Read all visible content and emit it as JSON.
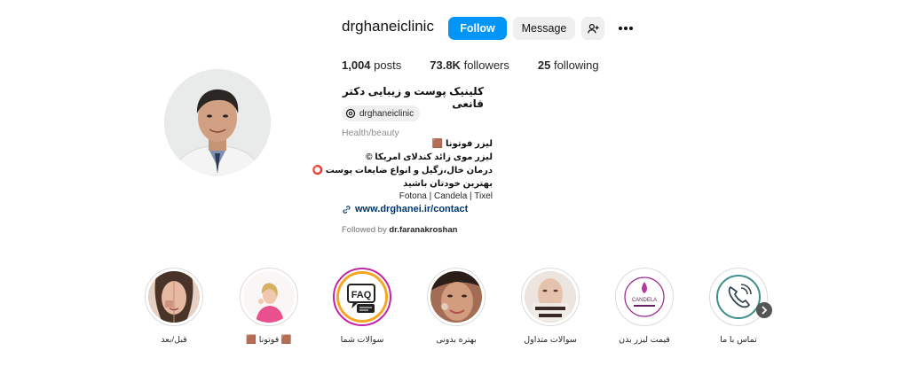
{
  "profile": {
    "username": "drghaneiclinic",
    "follow_label": "Follow",
    "message_label": "Message",
    "posts_count": "1,004",
    "posts_label": "posts",
    "followers_count": "73.8K",
    "followers_label": "followers",
    "following_count": "25",
    "following_label": "following",
    "full_name": "کلینیک پوست و زیبایی دکتر قانعی",
    "threads_handle": "drghaneiclinic",
    "category": "Health/beauty",
    "bio_lines": [
      "لیزر فوتونا 🟫",
      "لیزر موی زائد کندلای امریکا ©",
      "درمان خال،زگیل و انواع ضایعات پوست ⭕",
      "بهترین خودتان باشید"
    ],
    "brands": "Fotona | Candela | Tixel",
    "website": "www.drghanei.ir/contact",
    "followed_by_prefix": "Followed by",
    "followed_by_user": "dr.faranakroshan"
  },
  "highlights": [
    {
      "label": "قبل/بعد",
      "icon": "before-after-face"
    },
    {
      "label": "🟫 فوتونا 🟫",
      "icon": "woman-pink"
    },
    {
      "label": "سوالات شما",
      "icon": "faq-icon"
    },
    {
      "label": "بهتره بدونی",
      "icon": "woman-face"
    },
    {
      "label": "سوالات متداول",
      "icon": "face-with-text"
    },
    {
      "label": "قیمت لیزر بدن",
      "icon": "candela-logo"
    },
    {
      "label": "تماس با ما",
      "icon": "phone-icon"
    }
  ],
  "colors": {
    "follow_blue": "#0095f6",
    "link_blue": "#00376b",
    "secondary_text": "#8e8e8e",
    "button_gray": "#efefef"
  }
}
